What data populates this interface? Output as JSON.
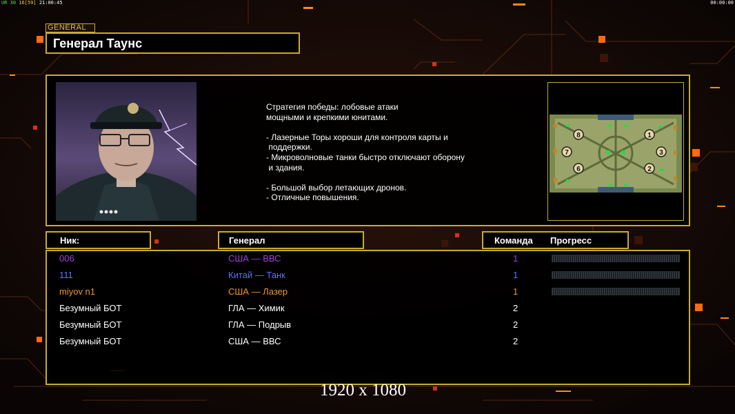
{
  "topbar": {
    "left_prefix": "UR",
    "left_a": "30",
    "left_b": "16",
    "left_c": "[59]",
    "left_time": "21:00:45",
    "right_time": "00:00:00"
  },
  "general": {
    "tag": "GENERAL",
    "name": "Генерал Таунс"
  },
  "strategy_text": "Стратегия победы: лобовые атаки\nмощными и крепкими юнитами.\n\n- Лазерные Торы хороши для контроля карты и\n поддержки.\n- Микроволновые танки быстро отключают оборону\n и здания.\n\n- Большой выбор летающих дронов.\n- Отличные повышения.",
  "map": {
    "positions": [
      "8",
      "7",
      "6",
      "1",
      "3",
      "2"
    ]
  },
  "table": {
    "headers": {
      "nick": "Ник:",
      "general": "Генерал",
      "team": "Команда",
      "progress": "Прогресс"
    },
    "rows": [
      {
        "nick": "006",
        "general": "США — ВВС",
        "team": "1",
        "color": "#a43fdc",
        "has_progress": true
      },
      {
        "nick": "111",
        "general": "Китай — Танк",
        "team": "1",
        "color": "#5f72ff",
        "has_progress": true
      },
      {
        "nick": "miyov n1",
        "general": "США — Лазер",
        "team": "1",
        "color": "#f0962a",
        "has_progress": true
      },
      {
        "nick": "Безумный БОТ",
        "general": "ГЛА — Химик",
        "team": "2",
        "color": "#ffffff",
        "has_progress": false
      },
      {
        "nick": "Безумный БОТ",
        "general": "ГЛА — Подрыв",
        "team": "2",
        "color": "#ffffff",
        "has_progress": false
      },
      {
        "nick": "Безумный БОТ",
        "general": "США — ВВС",
        "team": "2",
        "color": "#ffffff",
        "has_progress": false
      }
    ]
  },
  "watermark": "1920 x 1080",
  "colors": {
    "accent_gold": "#c9ad2a",
    "background": "#0d0706",
    "orange_square": "#ff6a10"
  }
}
